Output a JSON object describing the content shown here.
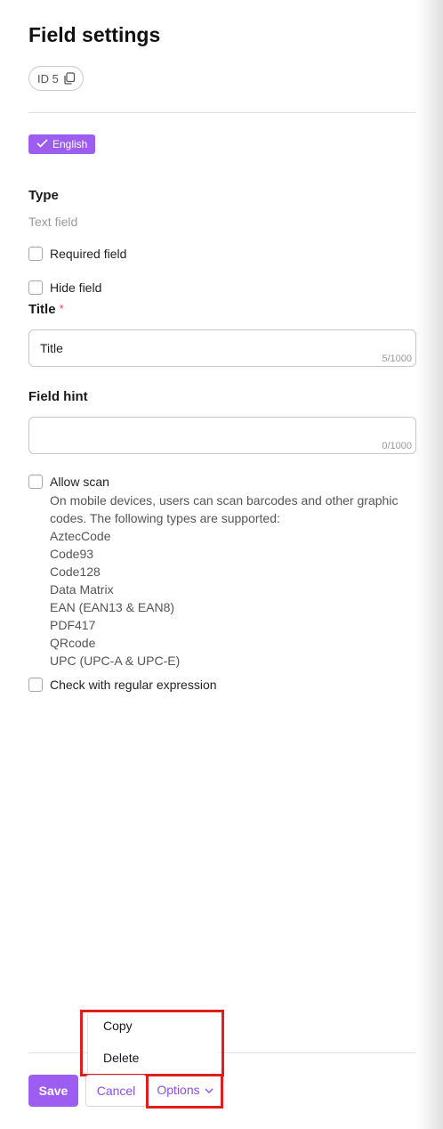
{
  "header": {
    "title": "Field settings",
    "id_label": "ID 5"
  },
  "language": {
    "label": "English",
    "color": "#9d5df0"
  },
  "type_section": {
    "label": "Type",
    "value": "Text field"
  },
  "checkboxes": {
    "required": "Required field",
    "hide": "Hide field",
    "allow_scan": "Allow scan",
    "regex": "Check with regular expression"
  },
  "title_field": {
    "label": "Title",
    "required_mark": "*",
    "value": "Title",
    "counter": "5/1000"
  },
  "hint_field": {
    "label": "Field hint",
    "value": "",
    "counter": "0/1000"
  },
  "scan": {
    "description": "On mobile devices, users can scan barcodes and other graphic codes. The following types are supported:",
    "types": [
      "AztecCode",
      "Code93",
      "Code128",
      "Data Matrix",
      "EAN (EAN13 & EAN8)",
      "PDF417",
      "QRcode",
      "UPC (UPC-A & UPC-E)"
    ]
  },
  "options_menu": {
    "items": [
      "Copy",
      "Delete"
    ]
  },
  "footer": {
    "save_label": "Save",
    "cancel_label": "Cancel",
    "options_label": "Options"
  },
  "colors": {
    "accent": "#9d5df0",
    "highlight": "#e01e1e"
  }
}
